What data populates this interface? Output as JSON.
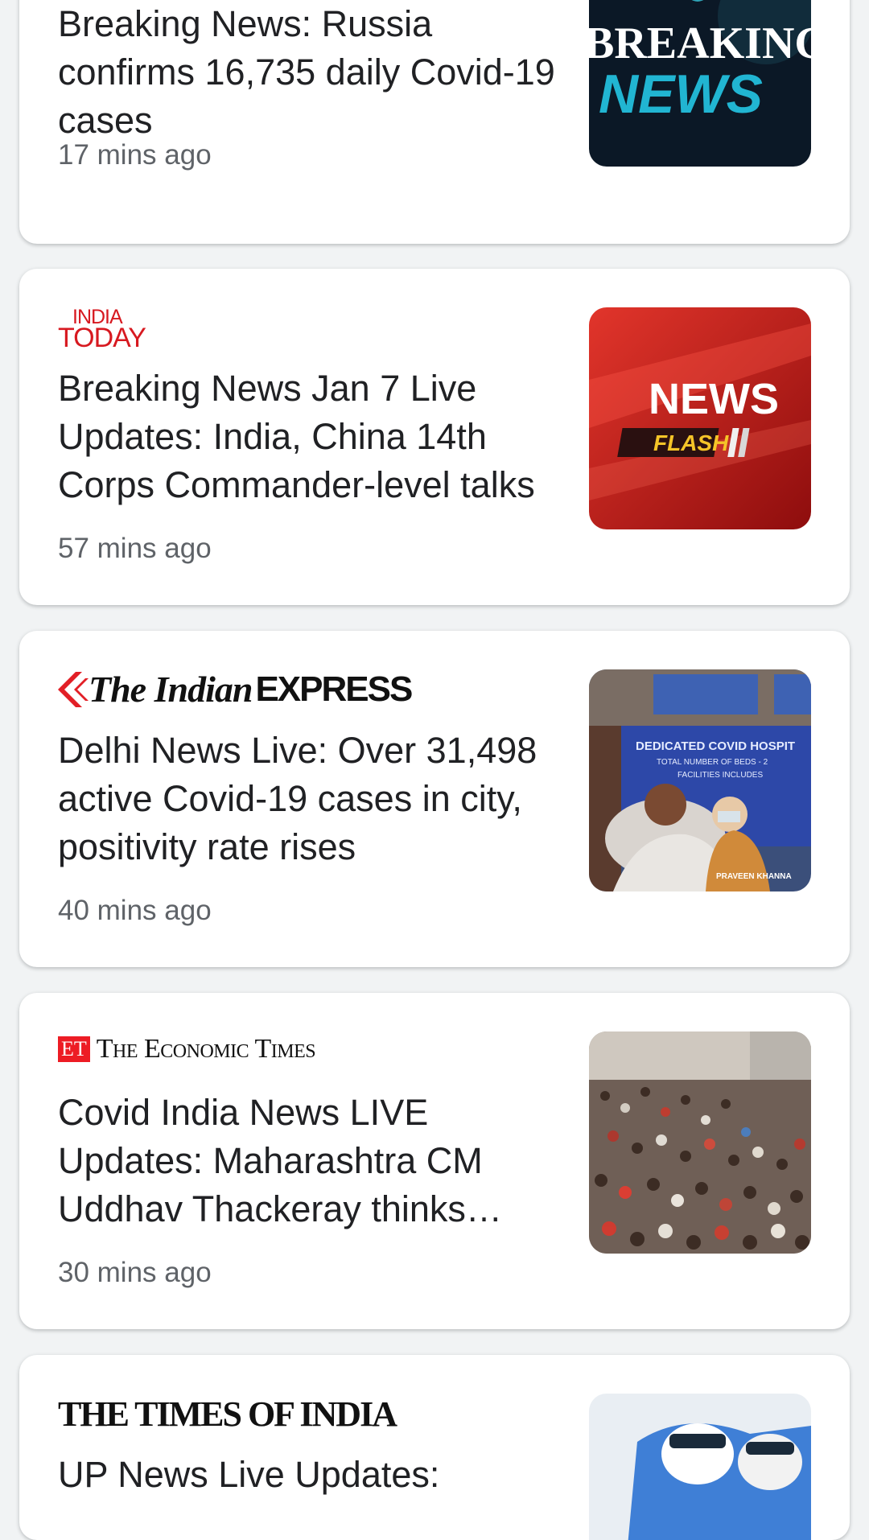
{
  "articles": [
    {
      "headline": "Breaking News: Russia confirms 16,735 daily Covid-19 cases",
      "time": "17 mins ago",
      "thumb_line1": "BREAKING",
      "thumb_line2": "NEWS"
    },
    {
      "source": {
        "line1": "INDIA",
        "line2": "TODAY"
      },
      "headline": "Breaking News Jan 7 Live Updates: India, China 14th Corps Commander-level talks",
      "time": "57 mins ago",
      "thumb_line1": "NEWS",
      "thumb_line2": "FLASH"
    },
    {
      "source": {
        "part1": "The Indian",
        "part2": "EXPRESS"
      },
      "headline": "Delhi News Live: Over 31,498 active Covid-19 cases in city, positivity rate rises",
      "time": "40 mins ago",
      "thumb_sign1": "DEDICATED COVID HOSPIT",
      "thumb_sign2": "TOTAL NUMBER OF BEDS - 2",
      "thumb_sign3": "FACILITIES INCLUDES",
      "thumb_credit": "PRAVEEN KHANNA"
    },
    {
      "source": {
        "badge": "ET",
        "name": "The Economic Times"
      },
      "headline": "Covid India News LIVE Updates: Maharashtra CM Uddhav Thackeray thinks lockdown",
      "time": "30 mins ago"
    },
    {
      "source": {
        "name": "THE TIMES OF INDIA"
      },
      "headline": "UP News Live Updates:"
    }
  ]
}
